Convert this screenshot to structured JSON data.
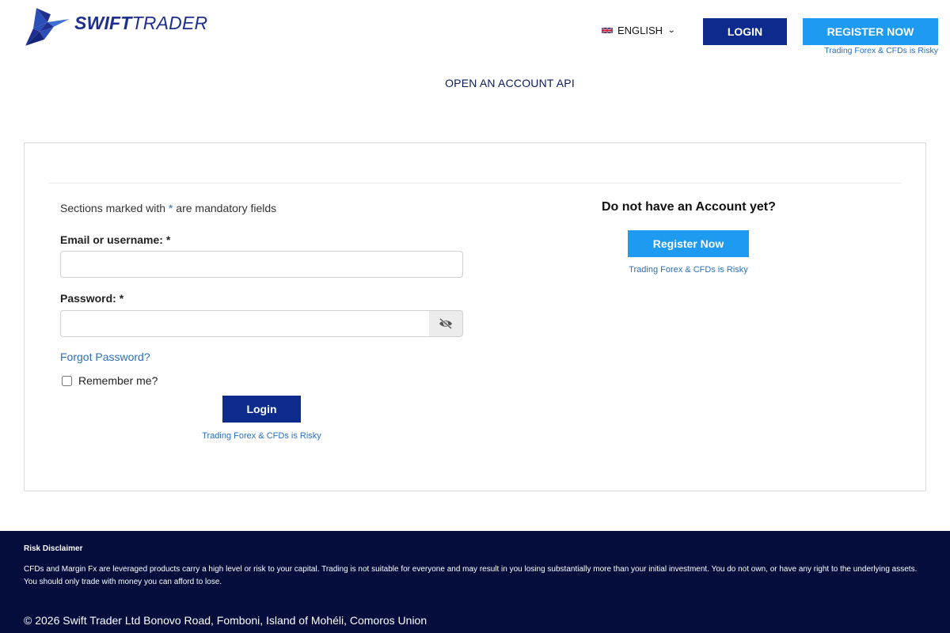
{
  "header": {
    "logo": {
      "word1": "SWIFT",
      "word2": "TRADER"
    },
    "language": {
      "label": "ENGLISH",
      "flag": "uk-flag-icon"
    },
    "login_label": "LOGIN",
    "register_label": "REGISTER NOW",
    "risk_label": "Trading Forex & CFDs is Risky"
  },
  "nav": {
    "api_link": "OPEN AN ACCOUNT API"
  },
  "login_form": {
    "mandatory_prefix": "Sections marked with ",
    "mandatory_asterisk": "*",
    "mandatory_suffix": " are mandatory fields",
    "email_label": "Email or username: *",
    "email_value": "",
    "password_label": "Password: *",
    "password_value": "",
    "forgot_label": "Forgot Password?",
    "remember_label": "Remember me?",
    "remember_checked": false,
    "submit_label": "Login",
    "risk_label": "Trading Forex & CFDs is Risky"
  },
  "register_panel": {
    "heading": "Do not have an Account yet?",
    "button_label": "Register Now",
    "risk_label": "Trading Forex & CFDs is Risky"
  },
  "footer": {
    "disclaimer_title": "Risk Disclaimer",
    "disclaimer_text": "CFDs and Margin Fx are leveraged products carry a high level or risk to your capital. Trading is not suitable for everyone and may result in you losing substantially more than your initial investment. You do not own, or have any right to the underlying assets. You should only trade with money you can afford to lose.",
    "copyright": "© 2026 Swift Trader Ltd Bonovo Road, Fomboni, Island of Mohéli, Comoros Union"
  },
  "colors": {
    "brand_navy": "#0c2b8c",
    "brand_blue": "#1e9bf0",
    "link_blue": "#2a6fc0",
    "footer_bg": "#050d3d"
  }
}
